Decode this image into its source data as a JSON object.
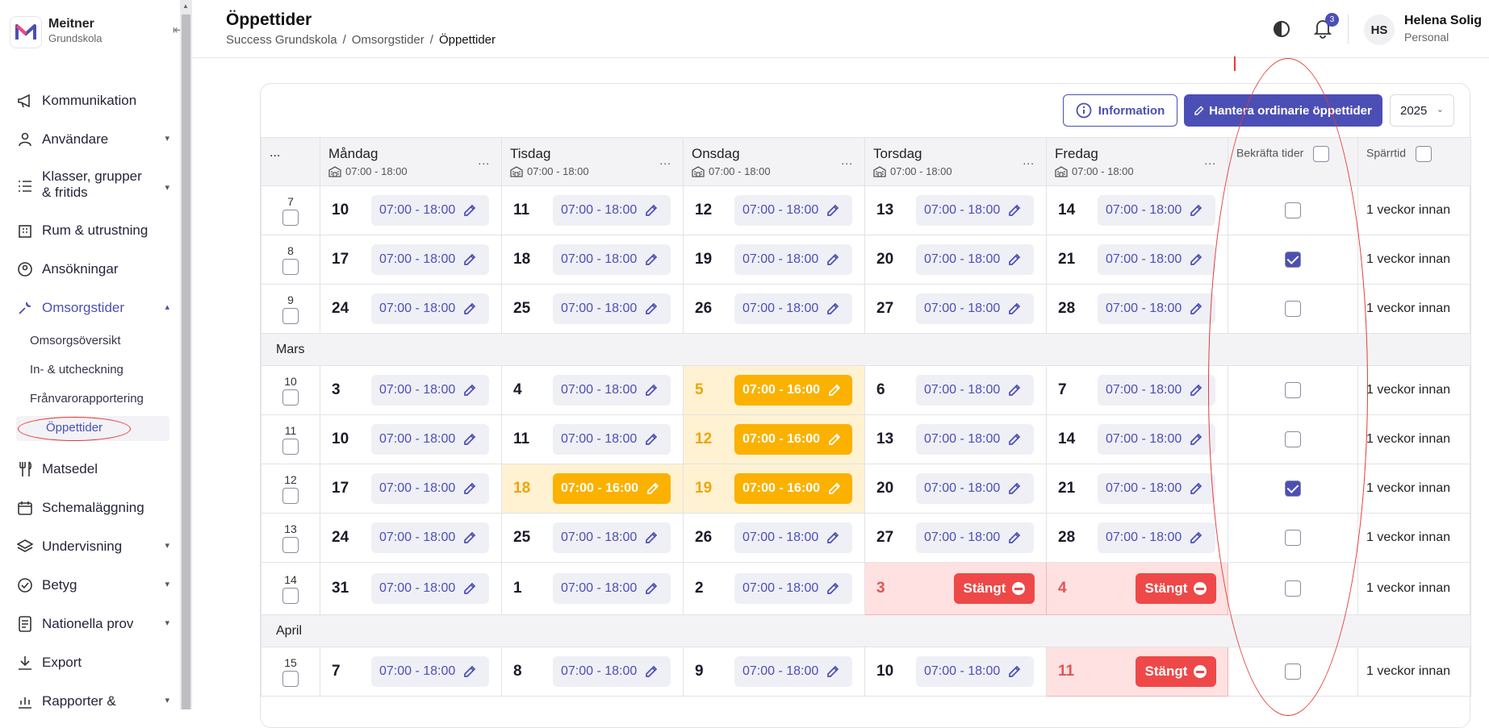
{
  "brand": {
    "name": "Meitner",
    "sub": "Grundskola"
  },
  "nav": {
    "kommunikation": "Kommunikation",
    "anvandare": "Användare",
    "klasser": "Klasser, grupper & fritids",
    "rum": "Rum & utrustning",
    "ansokningar": "Ansökningar",
    "omsorgstider": "Omsorgstider",
    "sub": {
      "oversikt": "Omsorgsöversikt",
      "incheckning": "In- & utcheckning",
      "franvaro": "Frånvarorapportering",
      "oppettider": "Öppettider"
    },
    "matsedel": "Matsedel",
    "schema": "Schemaläggning",
    "undervisning": "Undervisning",
    "betyg": "Betyg",
    "nationella": "Nationella prov",
    "export": "Export",
    "rapporter": "Rapporter &"
  },
  "header": {
    "title": "Öppettider",
    "crumbs": [
      "Success Grundskola",
      "Omsorgstider",
      "Öppettider"
    ],
    "notif_count": "3",
    "user_initials": "HS",
    "user_name": "Helena Solig",
    "user_role": "Personal"
  },
  "toolbar": {
    "info": "Information",
    "manage": "Hantera ordinarie öppettider",
    "year": "2025"
  },
  "table": {
    "wk_dots": "...",
    "days": [
      {
        "name": "Måndag",
        "hours": "07:00 - 18:00"
      },
      {
        "name": "Tisdag",
        "hours": "07:00 - 18:00"
      },
      {
        "name": "Onsdag",
        "hours": "07:00 - 18:00"
      },
      {
        "name": "Torsdag",
        "hours": "07:00 - 18:00"
      },
      {
        "name": "Fredag",
        "hours": "07:00 - 18:00"
      }
    ],
    "confirm_label": "Bekräfta tider",
    "sperr_label": "Spärrtid",
    "closed_label": "Stängt",
    "rows": [
      {
        "wk": "7",
        "days": [
          [
            "10",
            "07:00 - 18:00",
            ""
          ],
          [
            "11",
            "07:00 - 18:00",
            ""
          ],
          [
            "12",
            "07:00 - 18:00",
            ""
          ],
          [
            "13",
            "07:00 - 18:00",
            ""
          ],
          [
            "14",
            "07:00 - 18:00",
            ""
          ]
        ],
        "confirmed": false,
        "sperr": "1 veckor innan"
      },
      {
        "wk": "8",
        "days": [
          [
            "17",
            "07:00 - 18:00",
            ""
          ],
          [
            "18",
            "07:00 - 18:00",
            ""
          ],
          [
            "19",
            "07:00 - 18:00",
            ""
          ],
          [
            "20",
            "07:00 - 18:00",
            ""
          ],
          [
            "21",
            "07:00 - 18:00",
            ""
          ]
        ],
        "confirmed": true,
        "sperr": "1 veckor innan"
      },
      {
        "wk": "9",
        "days": [
          [
            "24",
            "07:00 - 18:00",
            ""
          ],
          [
            "25",
            "07:00 - 18:00",
            ""
          ],
          [
            "26",
            "07:00 - 18:00",
            ""
          ],
          [
            "27",
            "07:00 - 18:00",
            ""
          ],
          [
            "28",
            "07:00 - 18:00",
            ""
          ]
        ],
        "confirmed": false,
        "sperr": "1 veckor innan"
      },
      {
        "month": "Mars"
      },
      {
        "wk": "10",
        "days": [
          [
            "3",
            "07:00 - 18:00",
            ""
          ],
          [
            "4",
            "07:00 - 18:00",
            ""
          ],
          [
            "5",
            "07:00 - 16:00",
            "mod"
          ],
          [
            "6",
            "07:00 - 18:00",
            ""
          ],
          [
            "7",
            "07:00 - 18:00",
            ""
          ]
        ],
        "confirmed": false,
        "sperr": "1 veckor innan"
      },
      {
        "wk": "11",
        "days": [
          [
            "10",
            "07:00 - 18:00",
            ""
          ],
          [
            "11",
            "07:00 - 18:00",
            ""
          ],
          [
            "12",
            "07:00 - 16:00",
            "mod"
          ],
          [
            "13",
            "07:00 - 18:00",
            ""
          ],
          [
            "14",
            "07:00 - 18:00",
            ""
          ]
        ],
        "confirmed": false,
        "sperr": "1 veckor innan"
      },
      {
        "wk": "12",
        "days": [
          [
            "17",
            "07:00 - 18:00",
            ""
          ],
          [
            "18",
            "07:00 - 16:00",
            "mod"
          ],
          [
            "19",
            "07:00 - 16:00",
            "mod"
          ],
          [
            "20",
            "07:00 - 18:00",
            ""
          ],
          [
            "21",
            "07:00 - 18:00",
            ""
          ]
        ],
        "confirmed": true,
        "sperr": "1 veckor innan"
      },
      {
        "wk": "13",
        "days": [
          [
            "24",
            "07:00 - 18:00",
            ""
          ],
          [
            "25",
            "07:00 - 18:00",
            ""
          ],
          [
            "26",
            "07:00 - 18:00",
            ""
          ],
          [
            "27",
            "07:00 - 18:00",
            ""
          ],
          [
            "28",
            "07:00 - 18:00",
            ""
          ]
        ],
        "confirmed": false,
        "sperr": "1 veckor innan"
      },
      {
        "wk": "14",
        "days": [
          [
            "31",
            "07:00 - 18:00",
            ""
          ],
          [
            "1",
            "07:00 - 18:00",
            ""
          ],
          [
            "2",
            "07:00 - 18:00",
            ""
          ],
          [
            "3",
            "",
            "closed"
          ],
          [
            "4",
            "",
            "closed"
          ]
        ],
        "confirmed": false,
        "sperr": "1 veckor innan"
      },
      {
        "month": "April"
      },
      {
        "wk": "15",
        "days": [
          [
            "7",
            "07:00 - 18:00",
            ""
          ],
          [
            "8",
            "07:00 - 18:00",
            ""
          ],
          [
            "9",
            "07:00 - 18:00",
            ""
          ],
          [
            "10",
            "07:00 - 18:00",
            ""
          ],
          [
            "11",
            "",
            "closed"
          ]
        ],
        "confirmed": false,
        "sperr": "1 veckor innan"
      }
    ]
  },
  "colors": {
    "accent": "#4b4fb5",
    "modified": "#fbb100",
    "closed": "#ef4848",
    "annotation": "#e53935"
  }
}
